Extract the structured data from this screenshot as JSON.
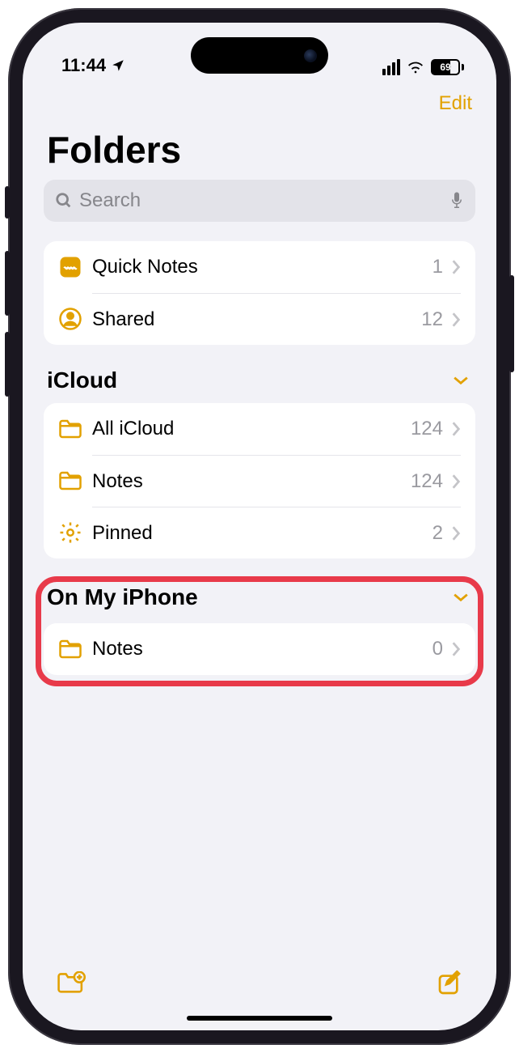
{
  "status": {
    "time": "11:44",
    "battery": "69"
  },
  "nav": {
    "edit": "Edit"
  },
  "title": "Folders",
  "search": {
    "placeholder": "Search"
  },
  "top_group": [
    {
      "icon": "quicknotes",
      "label": "Quick Notes",
      "count": "1"
    },
    {
      "icon": "shared",
      "label": "Shared",
      "count": "12"
    }
  ],
  "sections": [
    {
      "header": "iCloud",
      "rows": [
        {
          "icon": "folder",
          "label": "All iCloud",
          "count": "124"
        },
        {
          "icon": "folder",
          "label": "Notes",
          "count": "124"
        },
        {
          "icon": "gear",
          "label": "Pinned",
          "count": "2"
        }
      ]
    },
    {
      "header": "On My iPhone",
      "highlighted": true,
      "rows": [
        {
          "icon": "folder",
          "label": "Notes",
          "count": "0"
        }
      ]
    }
  ]
}
